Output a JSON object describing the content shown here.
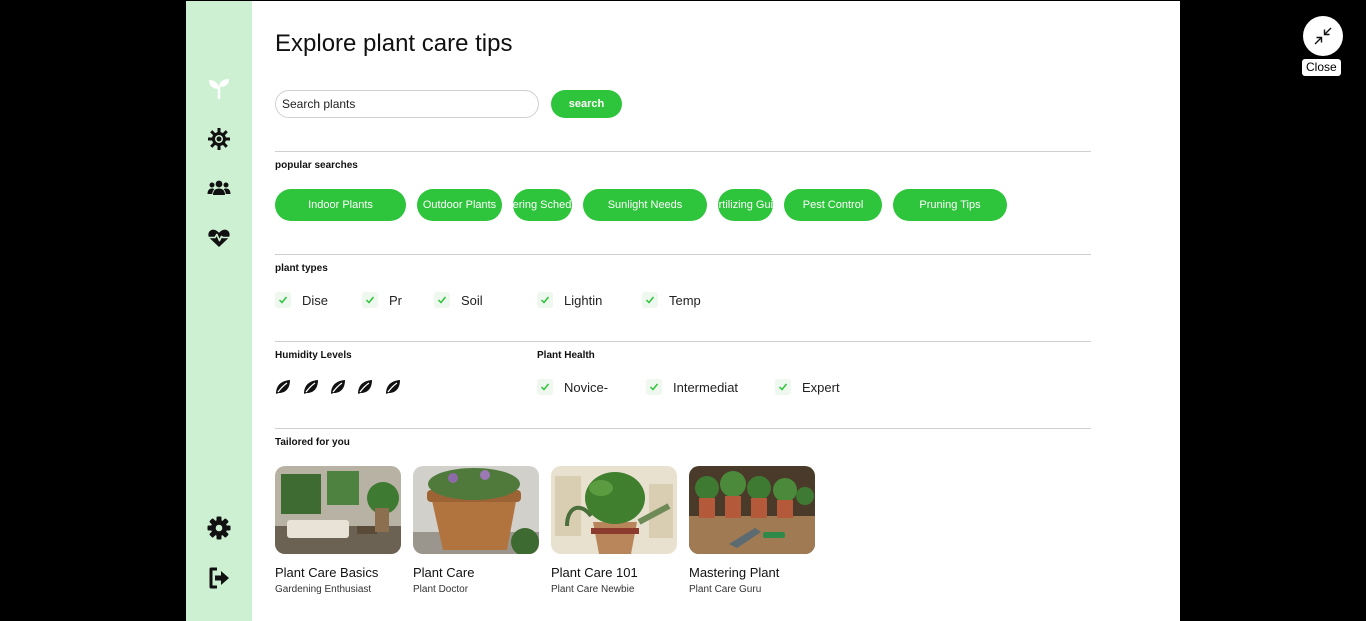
{
  "page": {
    "title": "Explore plant care tips",
    "close_label": "Close",
    "accent_color": "#2ec43b",
    "sidebar_color": "#cef0d2"
  },
  "sidebar": {
    "top_icons": [
      "sprout-icon",
      "sun-gear-icon",
      "users-icon",
      "heartbeat-icon"
    ],
    "bottom_icons": [
      "settings-gear-icon",
      "logout-icon"
    ]
  },
  "search": {
    "placeholder": "Search plants",
    "button_label": "search"
  },
  "popular": {
    "label": "popular searches",
    "chips": [
      "Indoor Plants",
      "Outdoor Plants",
      "Watering Schedules",
      "Sunlight Needs",
      "Fertilizing Guide",
      "Pest Control",
      "Pruning Tips"
    ]
  },
  "plant_types": {
    "label": "plant types",
    "options": [
      "Dise",
      "Pr",
      "Soil",
      "Lightin",
      "Temp"
    ]
  },
  "humidity": {
    "label": "Humidity Levels",
    "level": 5,
    "max": 5
  },
  "plant_health": {
    "label": "Plant Health",
    "options": [
      "Novice-",
      "Intermediat",
      "Expert"
    ]
  },
  "tailored": {
    "label": "Tailored for you",
    "cards": [
      {
        "title": "Plant Care Basics",
        "subtitle": "Gardening Enthusiast"
      },
      {
        "title": "Plant Care",
        "subtitle": "Plant Doctor"
      },
      {
        "title": "Plant Care 101",
        "subtitle": "Plant Care Newbie"
      },
      {
        "title": "Mastering Plant",
        "subtitle": "Plant Care Guru"
      }
    ]
  }
}
